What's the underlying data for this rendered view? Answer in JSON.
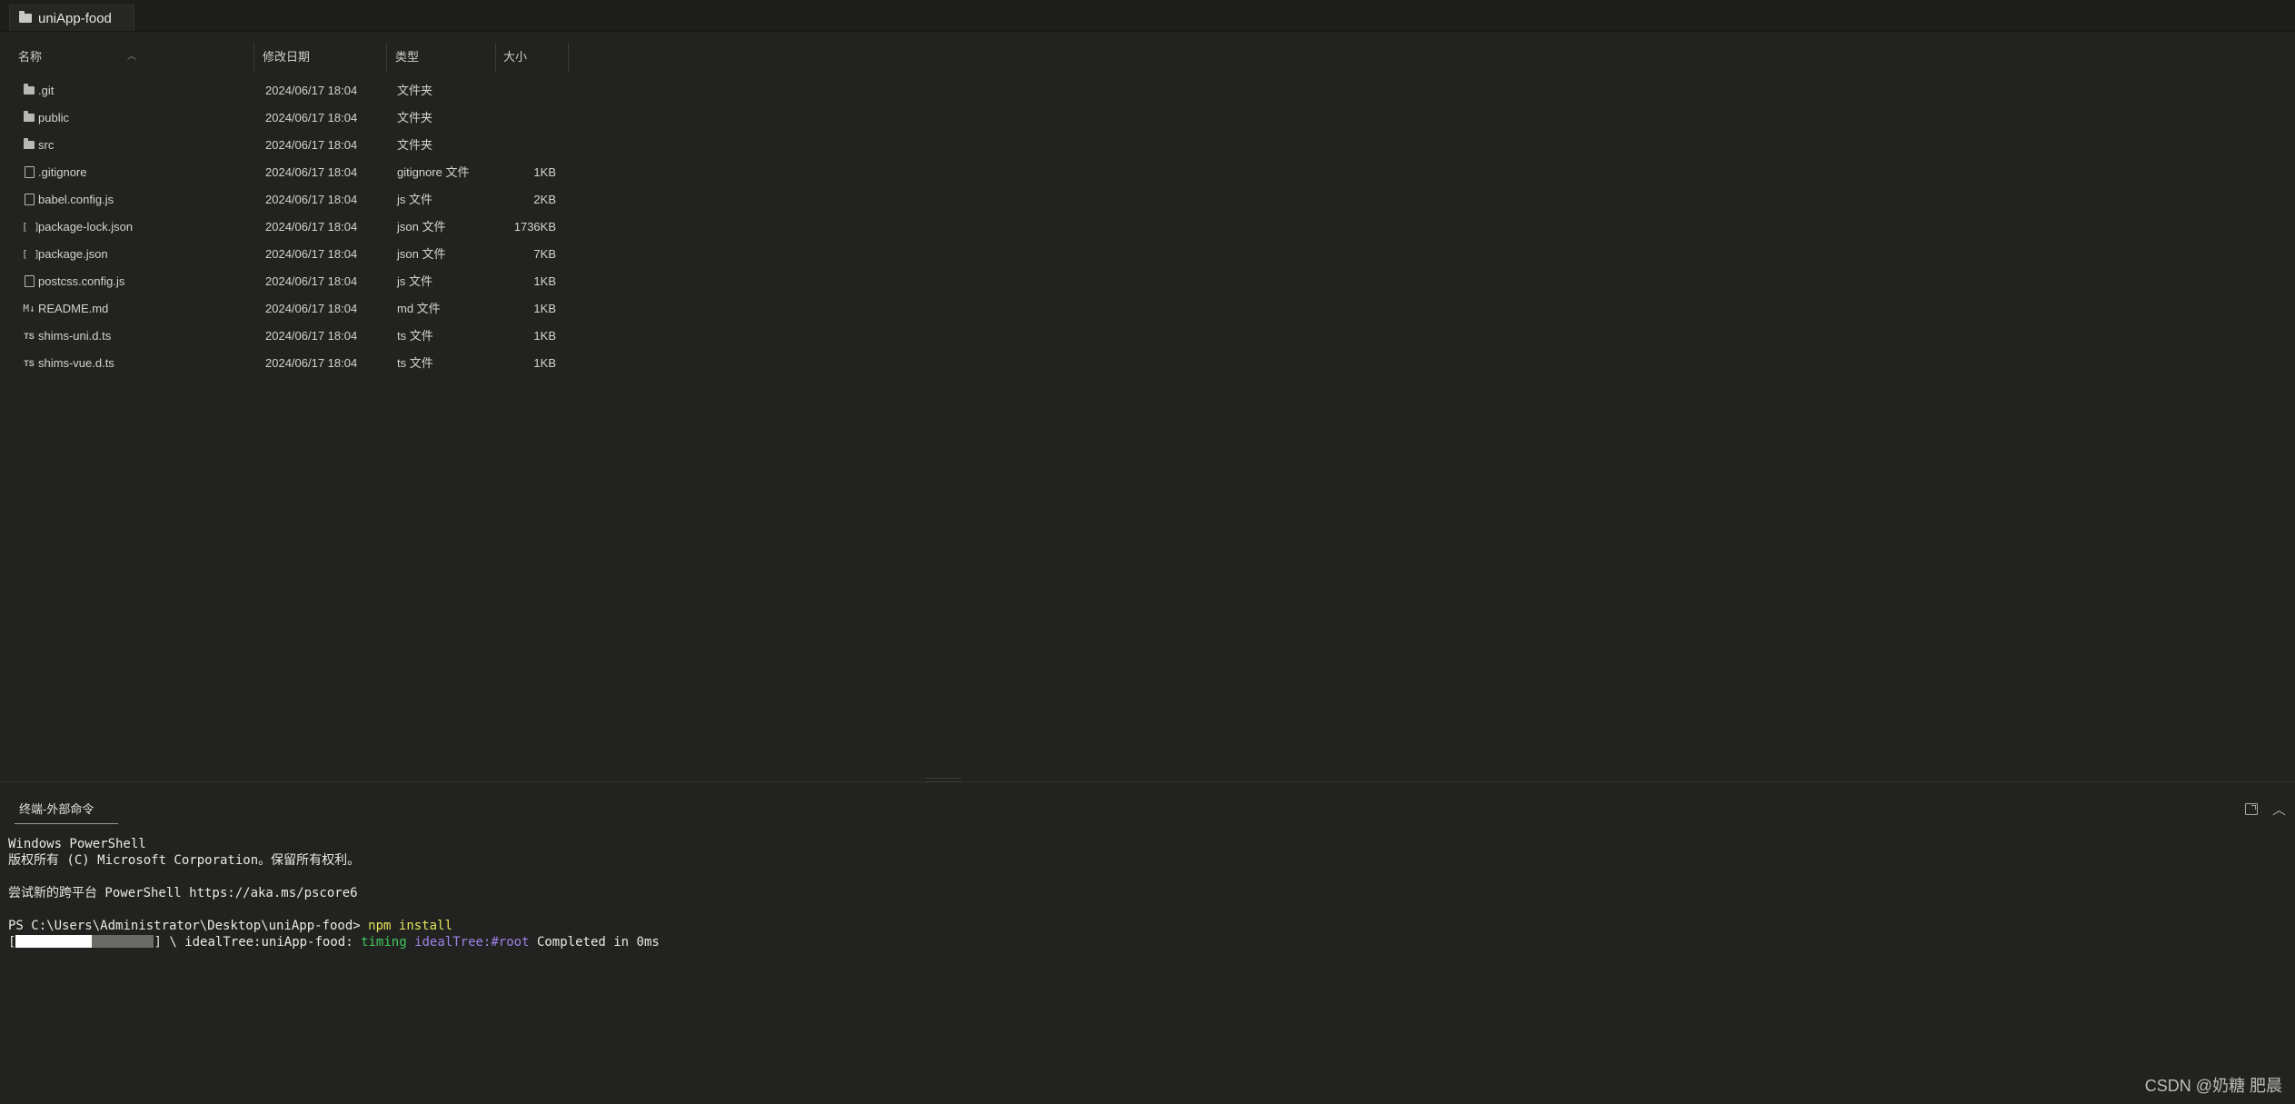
{
  "tab": {
    "title": "uniApp-food",
    "icon": "folder-icon"
  },
  "columns": {
    "name": "名称",
    "date": "修改日期",
    "type": "类型",
    "size": "大小"
  },
  "files": [
    {
      "icon": "folder",
      "name": ".git",
      "date": "2024/06/17 18:04",
      "type": "文件夹",
      "size": ""
    },
    {
      "icon": "folder",
      "name": "public",
      "date": "2024/06/17 18:04",
      "type": "文件夹",
      "size": ""
    },
    {
      "icon": "folder",
      "name": "src",
      "date": "2024/06/17 18:04",
      "type": "文件夹",
      "size": ""
    },
    {
      "icon": "file",
      "name": ".gitignore",
      "date": "2024/06/17 18:04",
      "type": "gitignore 文件",
      "size": "1KB"
    },
    {
      "icon": "file",
      "name": "babel.config.js",
      "date": "2024/06/17 18:04",
      "type": "js 文件",
      "size": "2KB"
    },
    {
      "icon": "json",
      "name": "package-lock.json",
      "date": "2024/06/17 18:04",
      "type": "json 文件",
      "size": "1736KB"
    },
    {
      "icon": "json",
      "name": "package.json",
      "date": "2024/06/17 18:04",
      "type": "json 文件",
      "size": "7KB"
    },
    {
      "icon": "file",
      "name": "postcss.config.js",
      "date": "2024/06/17 18:04",
      "type": "js 文件",
      "size": "1KB"
    },
    {
      "icon": "markdown",
      "name": "README.md",
      "date": "2024/06/17 18:04",
      "type": "md 文件",
      "size": "1KB"
    },
    {
      "icon": "typescript",
      "name": "shims-uni.d.ts",
      "date": "2024/06/17 18:04",
      "type": "ts 文件",
      "size": "1KB"
    },
    {
      "icon": "typescript",
      "name": "shims-vue.d.ts",
      "date": "2024/06/17 18:04",
      "type": "ts 文件",
      "size": "1KB"
    }
  ],
  "terminal": {
    "tab_label": "终端-外部命令",
    "lines": [
      "Windows PowerShell",
      "版权所有 (C) Microsoft Corporation。保留所有权利。",
      "",
      "尝试新的跨平台 PowerShell https://aka.ms/pscore6",
      ""
    ],
    "prompt": "PS C:\\Users\\Administrator\\Desktop\\uniApp-food>",
    "command": "npm install",
    "progress_fraction": 0.55,
    "progress": {
      "open": "[",
      "close": "]",
      "spinner": "\\",
      "task": "idealTree:uniApp-food:",
      "timing": "timing",
      "stage": "idealTree:#root",
      "message": "Completed in 0ms"
    }
  },
  "watermark": "CSDN @奶糖 肥晨"
}
